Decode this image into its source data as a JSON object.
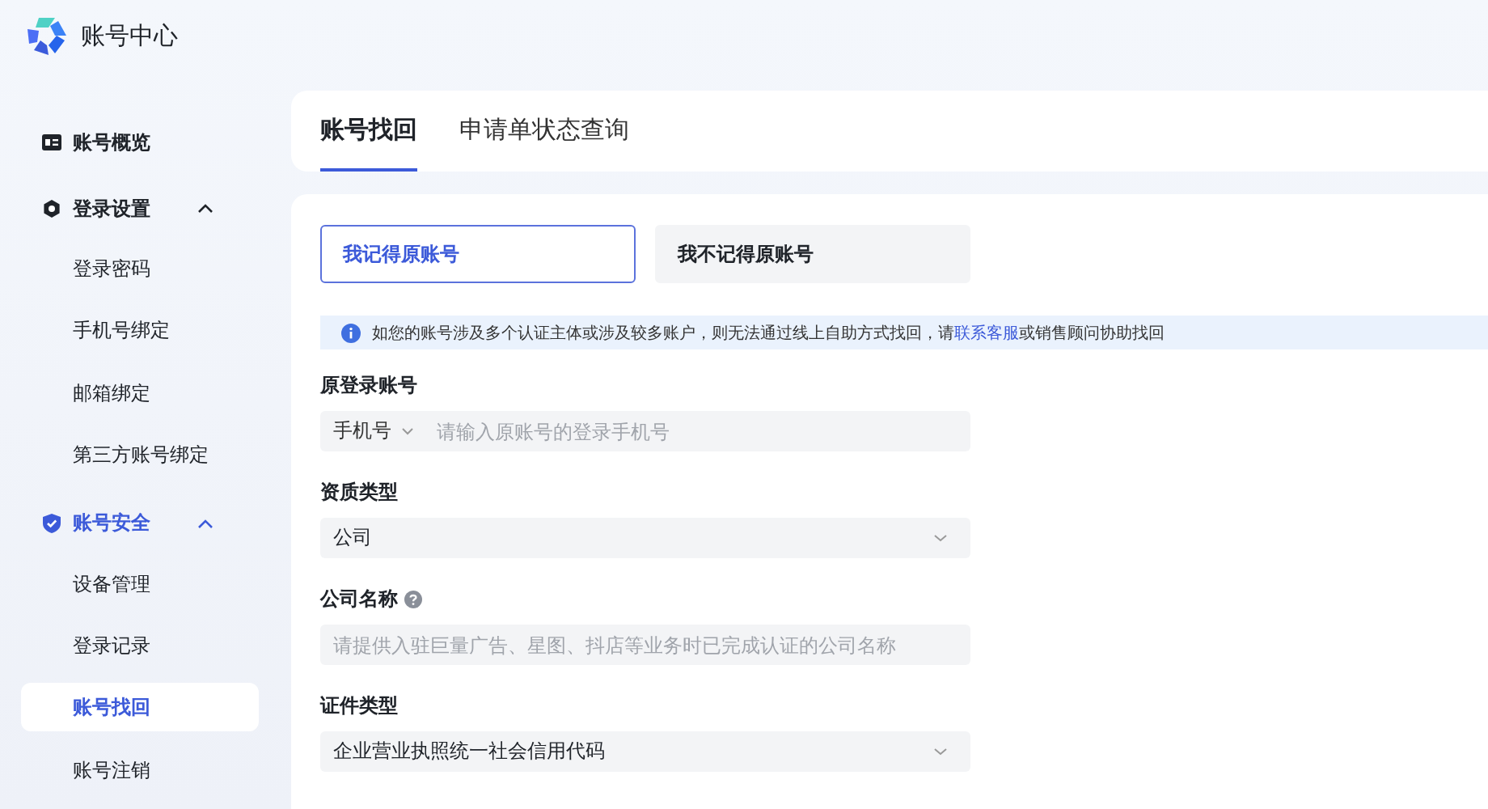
{
  "app_title": "账号中心",
  "sidebar": {
    "items": [
      {
        "kind": "link",
        "label": "账号概览",
        "selected": false
      },
      {
        "kind": "group",
        "label": "登录设置",
        "expanded": true,
        "selected": false,
        "children": [
          {
            "label": "登录密码",
            "selected": false
          },
          {
            "label": "手机号绑定",
            "selected": false
          },
          {
            "label": "邮箱绑定",
            "selected": false
          },
          {
            "label": "第三方账号绑定",
            "selected": false
          }
        ]
      },
      {
        "kind": "group",
        "label": "账号安全",
        "expanded": true,
        "selected": true,
        "children": [
          {
            "label": "设备管理",
            "selected": false
          },
          {
            "label": "登录记录",
            "selected": false
          },
          {
            "label": "账号找回",
            "selected": true
          },
          {
            "label": "账号注销",
            "selected": false
          }
        ]
      }
    ]
  },
  "tabs": [
    {
      "label": "账号找回",
      "selected": true
    },
    {
      "label": "申请单状态查询",
      "selected": false
    }
  ],
  "mode_options": [
    {
      "label": "我记得原账号",
      "selected": true
    },
    {
      "label": "我不记得原账号",
      "selected": false
    }
  ],
  "notice": {
    "text_before": "如您的账号涉及多个认证主体或涉及较多账户，则无法通过线上自助方式找回，请",
    "link": "联系客服",
    "text_after": "或销售顾问协助找回"
  },
  "form": [
    {
      "kind": "phone",
      "label": "原登录账号",
      "prefix": "手机号",
      "placeholder": "请输入原账号的登录手机号"
    },
    {
      "kind": "select",
      "label": "资质类型",
      "value": "公司"
    },
    {
      "kind": "text",
      "label": "公司名称",
      "help": true,
      "placeholder": "请提供入驻巨量广告、星图、抖店等业务时已完成认证的公司名称"
    },
    {
      "kind": "select",
      "label": "证件类型",
      "value": "企业营业执照统一社会信用代码"
    }
  ]
}
